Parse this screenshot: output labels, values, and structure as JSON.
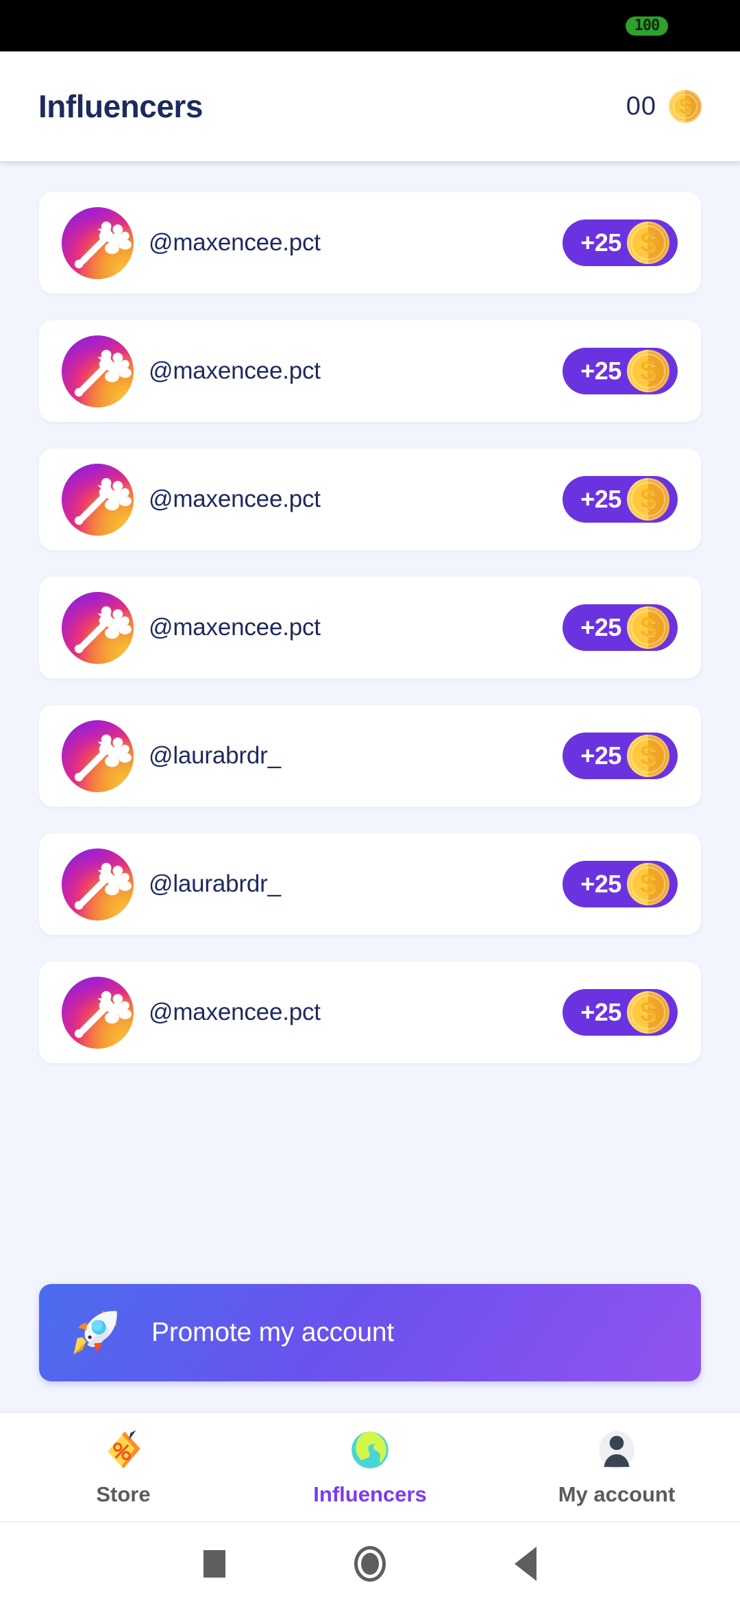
{
  "status_bar": {
    "battery_text": "100",
    "battery_color": "#2EA02C"
  },
  "header": {
    "title": "Influencers",
    "coin_count": "00",
    "coin_icon": "gold-coin-icon",
    "title_color": "#1D2A5E"
  },
  "theme": {
    "page_background": "#F2F5FD",
    "card_background": "#FFFFFF",
    "accent_purple": "#6B33E0",
    "active_nav_purple": "#7C3AEF",
    "text_navy": "#1D2A5E",
    "coin_gold": "#FFC93B"
  },
  "influencer_list": [
    {
      "username": "@maxencee.pct",
      "reward": "+25",
      "avatar_icon": "growth-arrow-avatar",
      "coin_icon": "gold-coin-icon"
    },
    {
      "username": "@maxencee.pct",
      "reward": "+25",
      "avatar_icon": "growth-arrow-avatar",
      "coin_icon": "gold-coin-icon"
    },
    {
      "username": "@maxencee.pct",
      "reward": "+25",
      "avatar_icon": "growth-arrow-avatar",
      "coin_icon": "gold-coin-icon"
    },
    {
      "username": "@maxencee.pct",
      "reward": "+25",
      "avatar_icon": "growth-arrow-avatar",
      "coin_icon": "gold-coin-icon"
    },
    {
      "username": "@laurabrdr_",
      "reward": "+25",
      "avatar_icon": "growth-arrow-avatar",
      "coin_icon": "gold-coin-icon"
    },
    {
      "username": "@laurabrdr_",
      "reward": "+25",
      "avatar_icon": "growth-arrow-avatar",
      "coin_icon": "gold-coin-icon"
    },
    {
      "username": "@maxencee.pct",
      "reward": "+25",
      "avatar_icon": "growth-arrow-avatar",
      "coin_icon": "gold-coin-icon"
    }
  ],
  "promote_button": {
    "label": "Promote my account",
    "icon": "rocket-icon"
  },
  "bottom_nav": {
    "items": [
      {
        "label": "Store",
        "icon": "price-tag-icon",
        "active": false
      },
      {
        "label": "Influencers",
        "icon": "globe-icon",
        "active": true
      },
      {
        "label": "My account",
        "icon": "person-icon",
        "active": false
      }
    ]
  },
  "system_nav": {
    "recents": "square-icon",
    "home": "circle-icon",
    "back": "triangle-back-icon"
  }
}
